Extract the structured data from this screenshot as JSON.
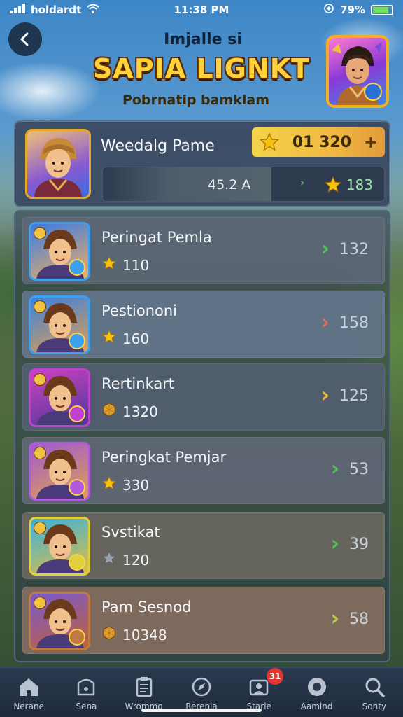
{
  "status": {
    "carrier": "holdardt",
    "time": "11:38 PM",
    "battery": "79%",
    "battery_level": 0.79
  },
  "header": {
    "subtitle": "Imjalle si",
    "title": "SAPIA LIGNKT",
    "tagline": "Pobrnatip bamklam"
  },
  "player": {
    "name": "Weedalg Pame",
    "score": "01 320",
    "progress_label": "45.2 A",
    "progress_fraction": 0.6,
    "stars": "183"
  },
  "rankings": [
    {
      "name": "Peringat Pemla",
      "score": "110",
      "score_icon": "star",
      "trend": "132",
      "trend_color": "#4fbf5a",
      "avatar_colors": [
        "#3a7ae6",
        "#f0b060"
      ],
      "frame": "#3aa0f0",
      "bg": "rgba(94,104,120,0.85)"
    },
    {
      "name": "Pestiononi",
      "score": "160",
      "score_icon": "star",
      "trend": "158",
      "trend_color": "#e06a5a",
      "avatar_colors": [
        "#3a80e0",
        "#e0a050"
      ],
      "frame": "#3aa0f0",
      "bg": "rgba(100,118,140,0.9)"
    },
    {
      "name": "Rertinkart",
      "score": "1320",
      "score_icon": "gem",
      "trend": "125",
      "trend_color": "#f0b83a",
      "avatar_colors": [
        "#d040c0",
        "#4a3a9a"
      ],
      "frame": "#c040d0",
      "bg": "rgba(82,94,112,0.9)"
    },
    {
      "name": "Peringkat Pemjar",
      "score": "330",
      "score_icon": "star",
      "trend": "53",
      "trend_color": "#4fbf5a",
      "avatar_colors": [
        "#a05ad0",
        "#e0a050"
      ],
      "frame": "#b05ae0",
      "bg": "rgba(96,104,118,0.9)"
    },
    {
      "name": "Svstikat",
      "score": "120",
      "score_icon": "star-outline",
      "trend": "39",
      "trend_color": "#4fbf5a",
      "avatar_colors": [
        "#3ab0e0",
        "#e0c040"
      ],
      "frame": "#e0d040",
      "bg": "rgba(106,104,96,0.9)"
    },
    {
      "name": "Pam Sesnod",
      "score": "10348",
      "score_icon": "gem",
      "trend": "58",
      "trend_color": "#b8d040",
      "avatar_colors": [
        "#7a5ad0",
        "#c0603a"
      ],
      "frame": "#c07a40",
      "bg": "rgba(132,110,96,0.92)"
    }
  ],
  "nav": [
    {
      "label": "Nerane",
      "icon": "home-icon"
    },
    {
      "label": "Sena",
      "icon": "shop-icon"
    },
    {
      "label": "Wrommg",
      "icon": "clipboard-icon"
    },
    {
      "label": "Rerenia",
      "icon": "compass-icon"
    },
    {
      "label": "Starie",
      "icon": "friends-icon",
      "badge": "31"
    },
    {
      "label": "Aamind",
      "icon": "eye-icon"
    },
    {
      "label": "Sonty",
      "icon": "search-icon"
    }
  ]
}
